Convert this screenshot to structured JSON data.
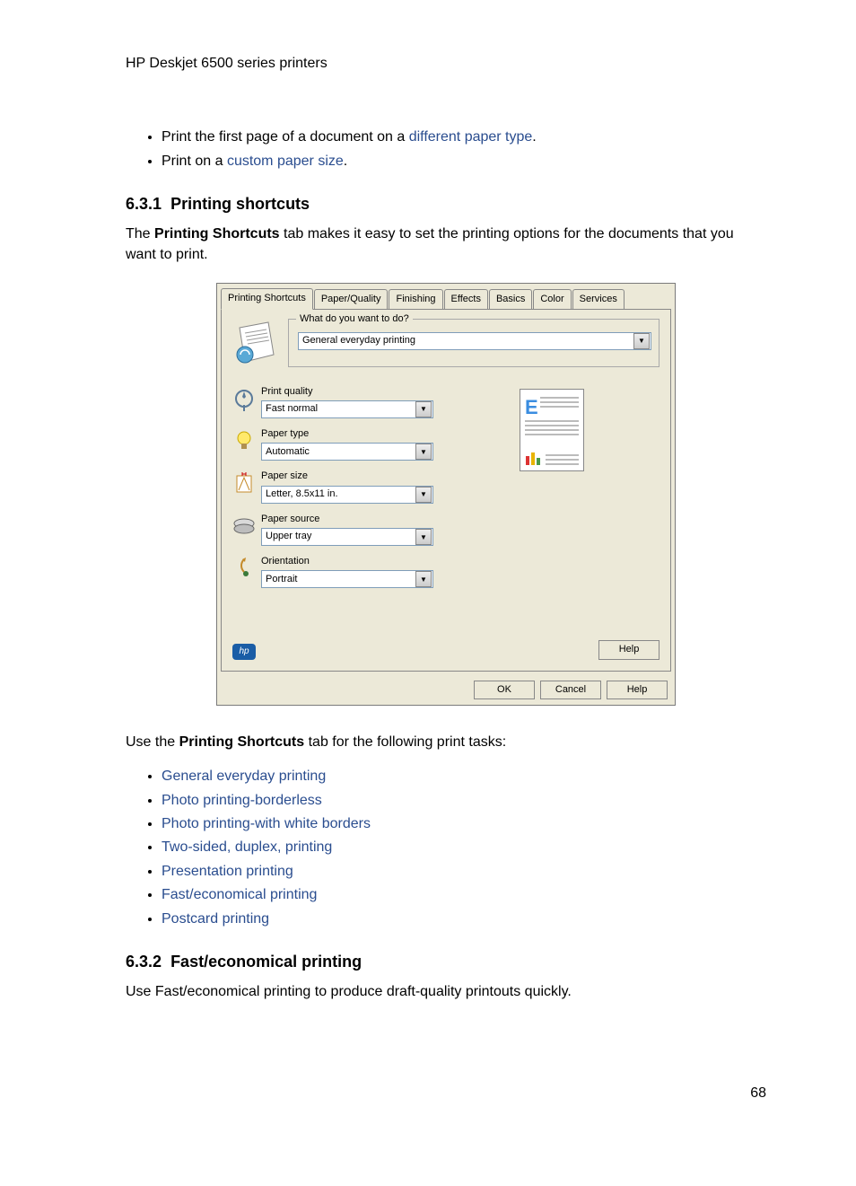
{
  "header": "HP Deskjet 6500 series printers",
  "intro_bullets": [
    {
      "pre": "Print the first page of a document on a ",
      "link": "different paper type",
      "post": "."
    },
    {
      "pre": "Print on a ",
      "link": "custom paper size",
      "post": "."
    }
  ],
  "section1": {
    "number": "6.3.1",
    "title": "Printing shortcuts",
    "para_pre": "The ",
    "para_bold": "Printing Shortcuts",
    "para_post": " tab makes it easy to set the printing options for the documents that you want to print."
  },
  "dialog": {
    "tabs": [
      "Printing Shortcuts",
      "Paper/Quality",
      "Finishing",
      "Effects",
      "Basics",
      "Color",
      "Services"
    ],
    "group_label": "What do you want to do?",
    "task_value": "General everyday printing",
    "opts": [
      {
        "label": "Print quality",
        "value": "Fast normal",
        "icon": "quality"
      },
      {
        "label": "Paper type",
        "value": "Automatic",
        "icon": "bulb"
      },
      {
        "label": "Paper size",
        "value": "Letter, 8.5x11 in.",
        "icon": "size"
      },
      {
        "label": "Paper source",
        "value": "Upper tray",
        "icon": "tray"
      },
      {
        "label": "Orientation",
        "value": "Portrait",
        "icon": "orient"
      }
    ],
    "buttons": {
      "help_inner": "Help",
      "ok": "OK",
      "cancel": "Cancel",
      "help": "Help"
    },
    "hp": "hp"
  },
  "after_dialog": {
    "pre": "Use the ",
    "bold": "Printing Shortcuts",
    "post": " tab for the following print tasks:"
  },
  "task_links": [
    "General everyday printing",
    "Photo printing-borderless",
    "Photo printing-with white borders",
    "Two-sided, duplex, printing",
    "Presentation printing",
    "Fast/economical printing",
    "Postcard printing"
  ],
  "section2": {
    "number": "6.3.2",
    "title": "Fast/economical printing",
    "para": "Use Fast/economical printing to produce draft-quality printouts quickly."
  },
  "page_number": "68"
}
